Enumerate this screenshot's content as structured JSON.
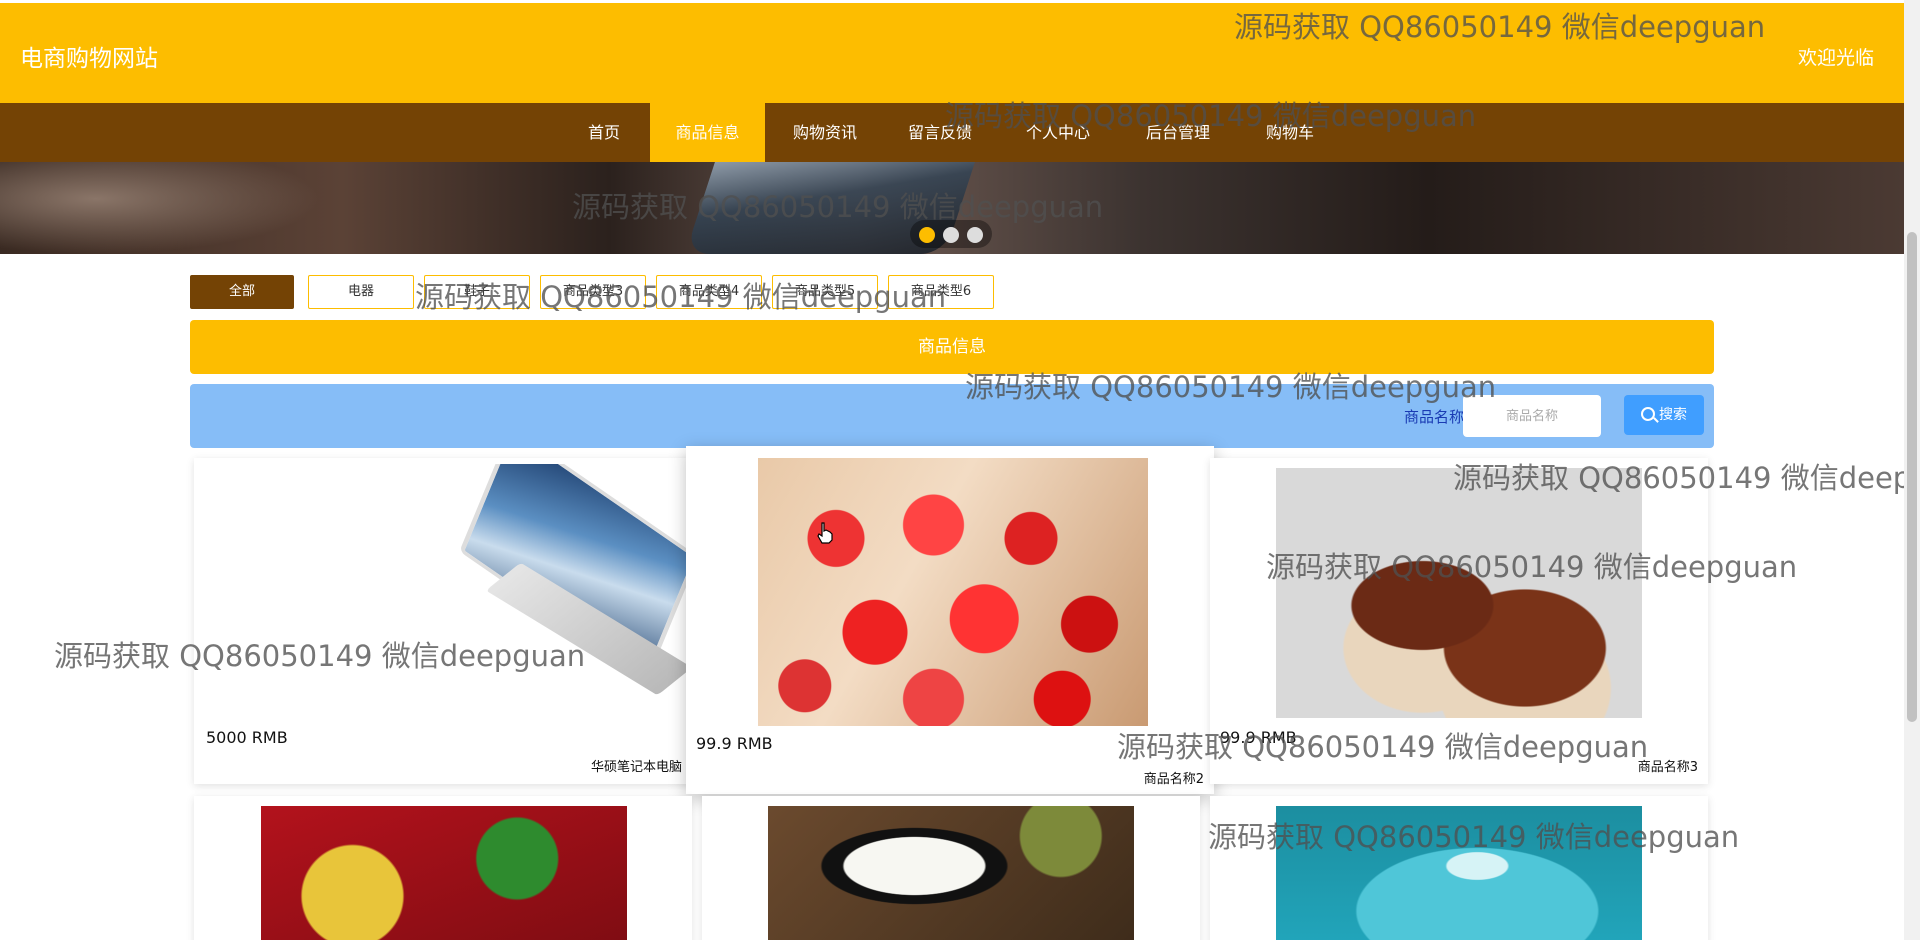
{
  "header": {
    "site_title": "电商购物网站",
    "welcome": "欢迎光临"
  },
  "nav": {
    "items": [
      {
        "label": "首页"
      },
      {
        "label": "商品信息",
        "active": true
      },
      {
        "label": "购物资讯"
      },
      {
        "label": "留言反馈"
      },
      {
        "label": "个人中心"
      },
      {
        "label": "后台管理"
      },
      {
        "label": "购物车"
      }
    ]
  },
  "banner": {
    "slides_total": 3,
    "active_slide": 1
  },
  "categories": [
    {
      "label": "全部",
      "active": true
    },
    {
      "label": "电器"
    },
    {
      "label": "鞋子"
    },
    {
      "label": "商品类型3"
    },
    {
      "label": "商品类型4"
    },
    {
      "label": "商品类型5"
    },
    {
      "label": "商品类型6"
    }
  ],
  "section": {
    "title": "商品信息"
  },
  "search": {
    "label": "商品名称",
    "placeholder": "商品名称",
    "button_label": "搜索"
  },
  "products": [
    {
      "price": "5000 RMB",
      "name": "华硕笔记本电脑",
      "image": "laptop-image"
    },
    {
      "price": "99.9 RMB",
      "name": "商品名称2",
      "image": "cherry-image"
    },
    {
      "price": "99.9 RMB",
      "name": "商品名称3",
      "image": "shoes-image"
    },
    {
      "price": "",
      "name": "",
      "image": "food-tray-image"
    },
    {
      "price": "",
      "name": "",
      "image": "rice-box-image"
    },
    {
      "price": "",
      "name": "",
      "image": "kettle-image"
    }
  ],
  "watermark": {
    "text": "源码获取 QQ86050149 微信deepguan"
  },
  "colors": {
    "brand_yellow": "#fdbd00",
    "nav_brown": "#744305",
    "search_blue": "#86bdf7",
    "button_blue": "#409eff"
  }
}
